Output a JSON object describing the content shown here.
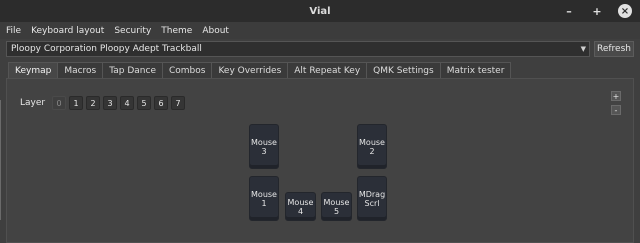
{
  "window": {
    "title": "Vial",
    "minimize": "–",
    "maximize": "+",
    "close": "×"
  },
  "menu": [
    "File",
    "Keyboard layout",
    "Security",
    "Theme",
    "About"
  ],
  "device": {
    "selected": "Ploopy Corporation Ploopy Adept Trackball",
    "dropdown_arrow": "▼",
    "refresh_label": "Refresh"
  },
  "tabs": [
    {
      "label": "Keymap",
      "active": true
    },
    {
      "label": "Macros"
    },
    {
      "label": "Tap Dance"
    },
    {
      "label": "Combos"
    },
    {
      "label": "Key Overrides"
    },
    {
      "label": "Alt Repeat Key"
    },
    {
      "label": "QMK Settings"
    },
    {
      "label": "Matrix tester"
    }
  ],
  "layers": {
    "label": "Layer",
    "items": [
      "0",
      "1",
      "2",
      "3",
      "4",
      "5",
      "6",
      "7"
    ],
    "selected": "0"
  },
  "zoom": {
    "in": "+",
    "out": "-"
  },
  "keys": [
    {
      "line1": "Mouse",
      "line2": "3"
    },
    {
      "line1": "Mouse",
      "line2": "2"
    },
    {
      "line1": "Mouse",
      "line2": "1"
    },
    {
      "line1": "Mouse",
      "line2": "4"
    },
    {
      "line1": "Mouse",
      "line2": "5"
    },
    {
      "line1": "MDrag",
      "line2": "Scrl"
    }
  ]
}
